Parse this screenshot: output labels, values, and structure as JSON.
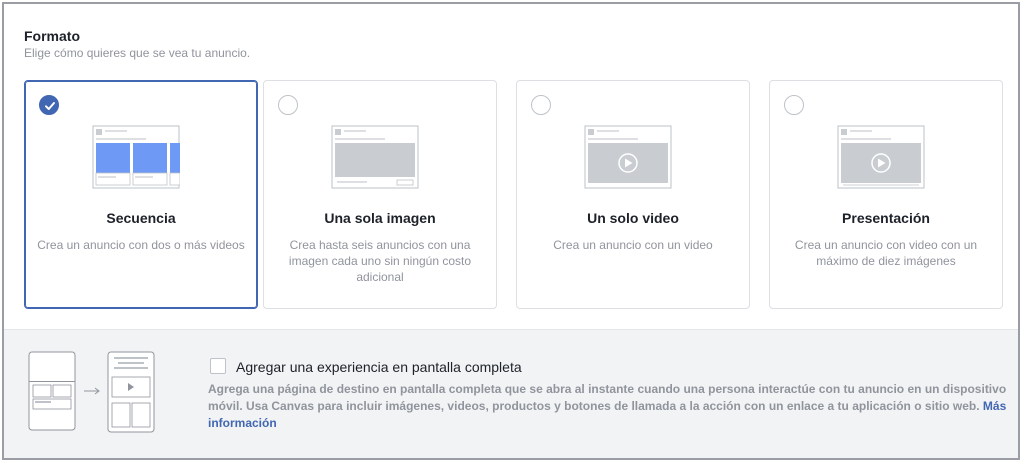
{
  "format": {
    "title": "Formato",
    "subtitle": "Elige cómo quieres que se vea tu anuncio."
  },
  "cards": [
    {
      "name": "Secuencia",
      "description": "Crea un anuncio con dos o más videos",
      "selected": true,
      "icon": "carousel-icon"
    },
    {
      "name": "Una sola imagen",
      "description": "Crea hasta seis anuncios con una imagen cada uno sin ningún costo adicional",
      "selected": false,
      "icon": "single-image-icon"
    },
    {
      "name": "Un solo video",
      "description": "Crea un anuncio con un video",
      "selected": false,
      "icon": "single-video-icon"
    },
    {
      "name": "Presentación",
      "description": "Crea un anuncio con video con un máximo de diez imágenes",
      "selected": false,
      "icon": "slideshow-icon"
    }
  ],
  "canvas": {
    "checkbox_label": "Agregar una experiencia en pantalla completa",
    "checked": false,
    "description": "Agrega una página de destino en pantalla completa que se abra al instante cuando una persona interactúe con tu anuncio en un dispositivo móvil. Usa Canvas para incluir imágenes, videos, productos y botones de llamada a la acción con un enlace a tu aplicación o sitio web.",
    "link_text": "Más información"
  },
  "colors": {
    "accent": "#4267b2",
    "thumb_blue": "#6e9af5",
    "thumb_gray": "#c9ccd1"
  }
}
